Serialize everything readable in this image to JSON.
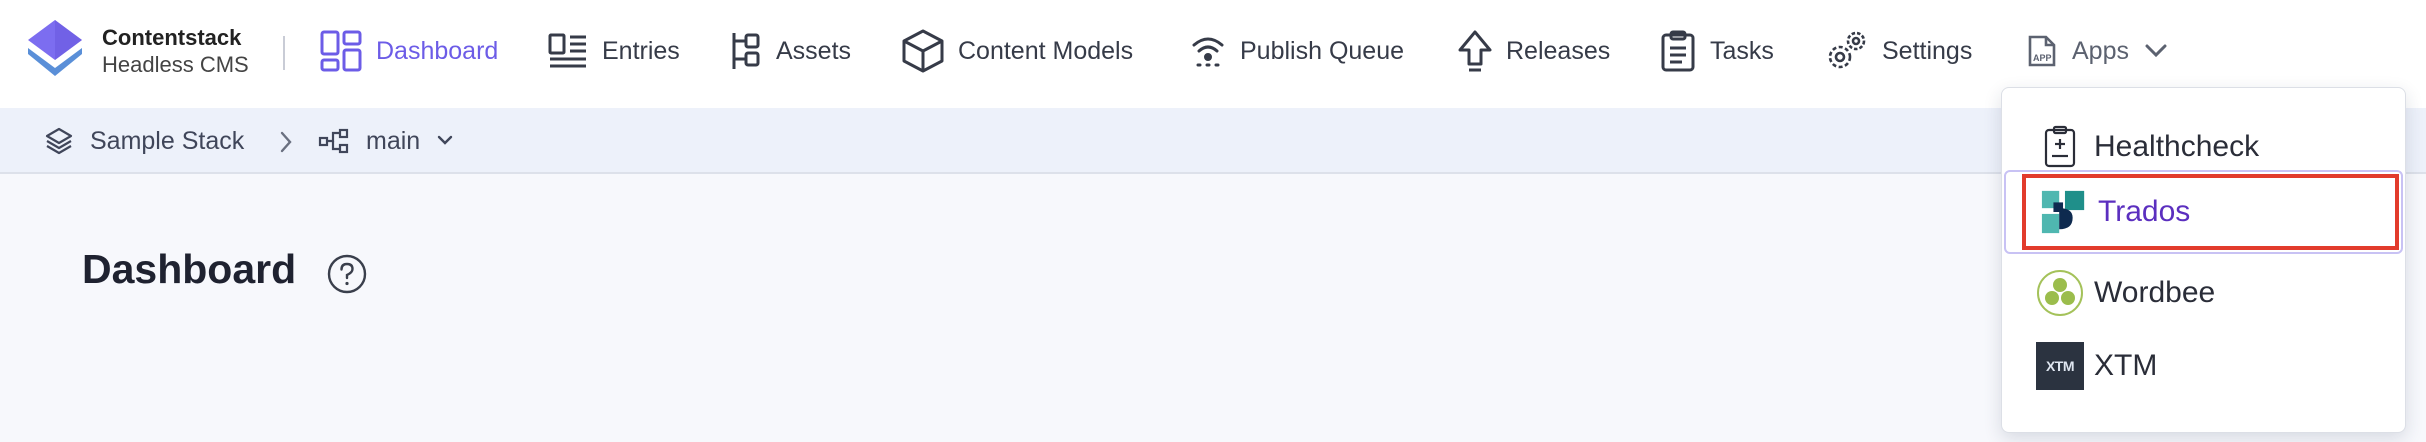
{
  "brand": {
    "name": "Contentstack",
    "subtitle": "Headless CMS"
  },
  "nav": {
    "dashboard": "Dashboard",
    "entries": "Entries",
    "assets": "Assets",
    "content_models": "Content Models",
    "publish_queue": "Publish Queue",
    "releases": "Releases",
    "tasks": "Tasks",
    "settings": "Settings",
    "apps": "Apps"
  },
  "breadcrumb": {
    "stack": "Sample Stack",
    "branch": "main"
  },
  "page": {
    "title": "Dashboard"
  },
  "apps_menu": {
    "items": [
      {
        "label": "Healthcheck",
        "icon": "clipboard-plus-icon"
      },
      {
        "label": "Trados",
        "icon": "trados-logo-icon"
      },
      {
        "label": "Wordbee",
        "icon": "wordbee-logo-icon"
      },
      {
        "label": "XTM",
        "icon": "xtm-logo-icon"
      }
    ],
    "selected": "Trados",
    "xtm_logo_text": "XTM"
  },
  "colors": {
    "accent": "#6c5ce7",
    "highlight": "#e23b2c",
    "nav_bg": "#ffffff",
    "crumb_bg": "#edf1fa"
  }
}
